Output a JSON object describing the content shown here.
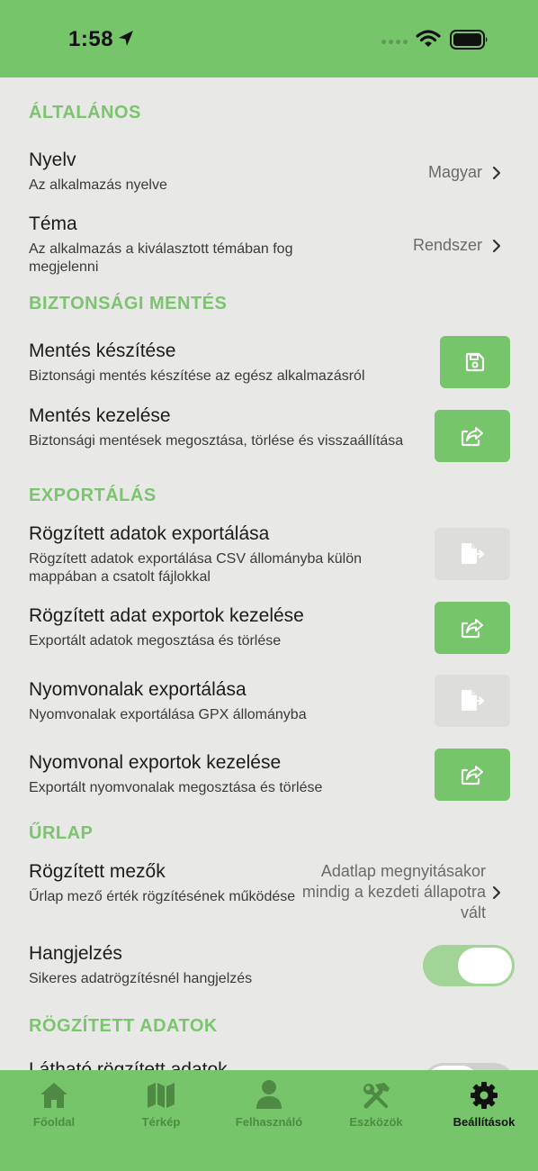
{
  "status_bar": {
    "time": "1:58"
  },
  "sections": [
    {
      "title": "ÁLTALÁNOS"
    },
    {
      "title": "BIZTONSÁGI MENTÉS"
    },
    {
      "title": "EXPORTÁLÁS"
    },
    {
      "title": "ŰRLAP"
    },
    {
      "title": "RÖGZÍTETT ADATOK"
    }
  ],
  "settings": {
    "language": {
      "title": "Nyelv",
      "subtitle": "Az alkalmazás nyelve",
      "value": "Magyar"
    },
    "theme": {
      "title": "Téma",
      "subtitle": "Az alkalmazás a kiválasztott témában fog megjelenni",
      "value": "Rendszer"
    },
    "backup_create": {
      "title": "Mentés készítése",
      "subtitle": "Biztonsági mentés készítése az egész alkalmazásról"
    },
    "backup_manage": {
      "title": "Mentés kezelése",
      "subtitle": "Biztonsági mentések megosztása, törlése és visszaállítása"
    },
    "data_export": {
      "title": "Rögzített adatok exportálása",
      "subtitle": "Rögzített adatok exportálása CSV állományba külön mappában a csatolt fájlokkal"
    },
    "data_export_manage": {
      "title": "Rögzített adat exportok kezelése",
      "subtitle": "Exportált adatok megosztása és törlése"
    },
    "track_export": {
      "title": "Nyomvonalak exportálása",
      "subtitle": "Nyomvonalak exportálása GPX állományba"
    },
    "track_export_manage": {
      "title": "Nyomvonal exportok kezelése",
      "subtitle": "Exportált nyomvonalak megosztása és törlése"
    },
    "fixed_fields": {
      "title": "Rögzített mezők",
      "subtitle": "Űrlap mező érték rögzítésének működése",
      "value": "Adatlap megnyitásakor mindig a kezdeti állapotra vált"
    },
    "sound": {
      "title": "Hangjelzés",
      "subtitle": "Sikeres adatrögzítésnél hangjelzés",
      "enabled": true
    },
    "visible_data": {
      "title": "Látható rögzített adatok"
    }
  },
  "tabs": [
    {
      "label": "Főoldal",
      "icon": "home-icon"
    },
    {
      "label": "Térkép",
      "icon": "map-icon"
    },
    {
      "label": "Felhasználó",
      "icon": "user-icon"
    },
    {
      "label": "Eszközök",
      "icon": "tools-icon"
    },
    {
      "label": "Beállítások",
      "icon": "gear-icon",
      "active": true
    }
  ],
  "colors": {
    "accent": "#76c56b",
    "section_title": "#7cc46f",
    "background": "#e8e8e6",
    "disabled_button": "#dddddb"
  }
}
